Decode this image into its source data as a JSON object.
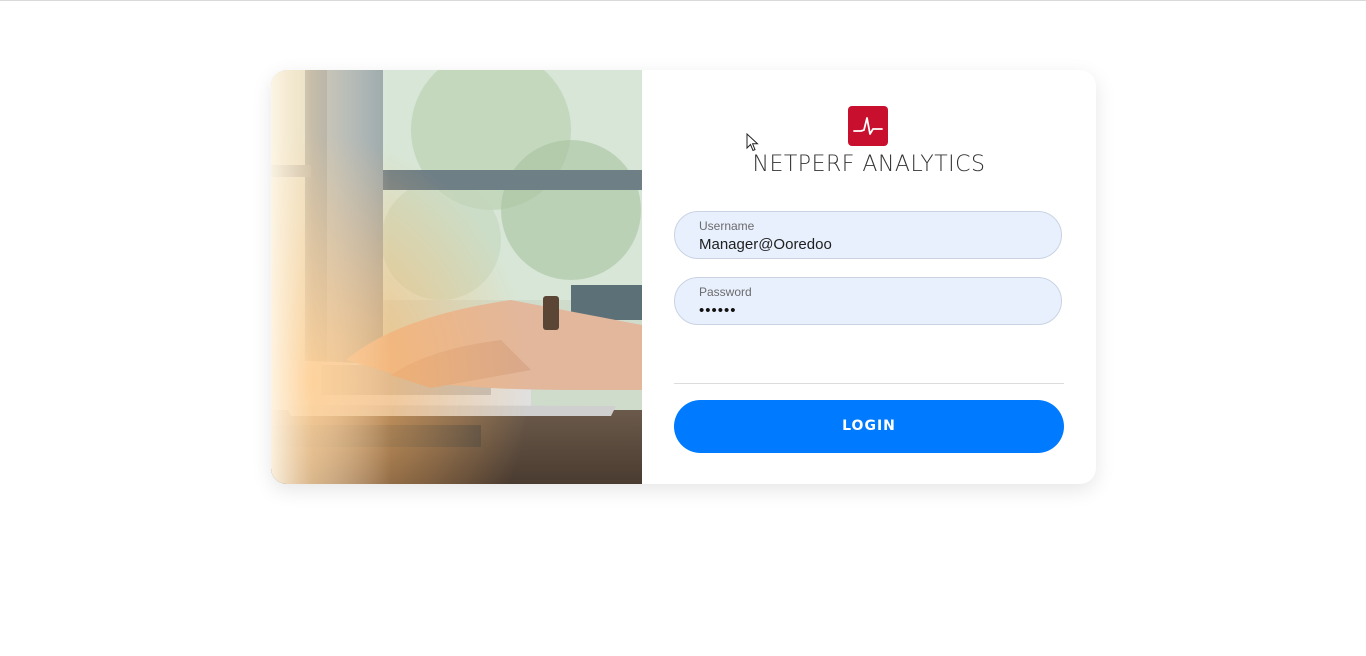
{
  "brand": {
    "name": "NETPERF ANALYTICS",
    "logo_icon": "pulse-waveform-icon",
    "logo_color": "#c8102e"
  },
  "login_form": {
    "username": {
      "label": "Username",
      "value": "Manager@Ooredoo"
    },
    "password": {
      "label": "Password",
      "masked_value": "••••••"
    },
    "submit_label": "LOGIN",
    "accent_color": "#007bff"
  },
  "hero_image": {
    "description_icon": "hands-typing-laptop-photo"
  }
}
